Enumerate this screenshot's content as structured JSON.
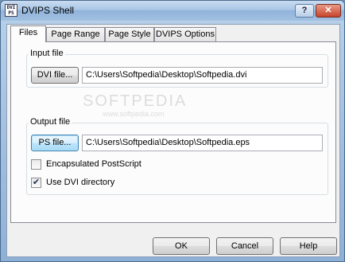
{
  "window": {
    "icon_text": "DVI PS",
    "title": "DVIPS Shell",
    "help_button": "?",
    "close_button": "✕"
  },
  "tabs": [
    {
      "label": "Files",
      "active": true
    },
    {
      "label": "Page Range",
      "active": false
    },
    {
      "label": "Page Style",
      "active": false
    },
    {
      "label": "DVIPS Options",
      "active": false
    }
  ],
  "input_group": {
    "label": "Input file",
    "button": "DVI file...",
    "value": "C:\\Users\\Softpedia\\Desktop\\Softpedia.dvi"
  },
  "output_group": {
    "label": "Output file",
    "button": "PS file...",
    "value": "C:\\Users\\Softpedia\\Desktop\\Softpedia.eps",
    "encapsulated_label": "Encapsulated PostScript",
    "encapsulated_checked": false,
    "use_dvi_dir_label": "Use DVI directory",
    "use_dvi_dir_checked": true
  },
  "watermark": {
    "text": "SOFTPEDIA",
    "sub": "www.softpedia.com"
  },
  "footer": {
    "ok": "OK",
    "cancel": "Cancel",
    "help": "Help"
  }
}
